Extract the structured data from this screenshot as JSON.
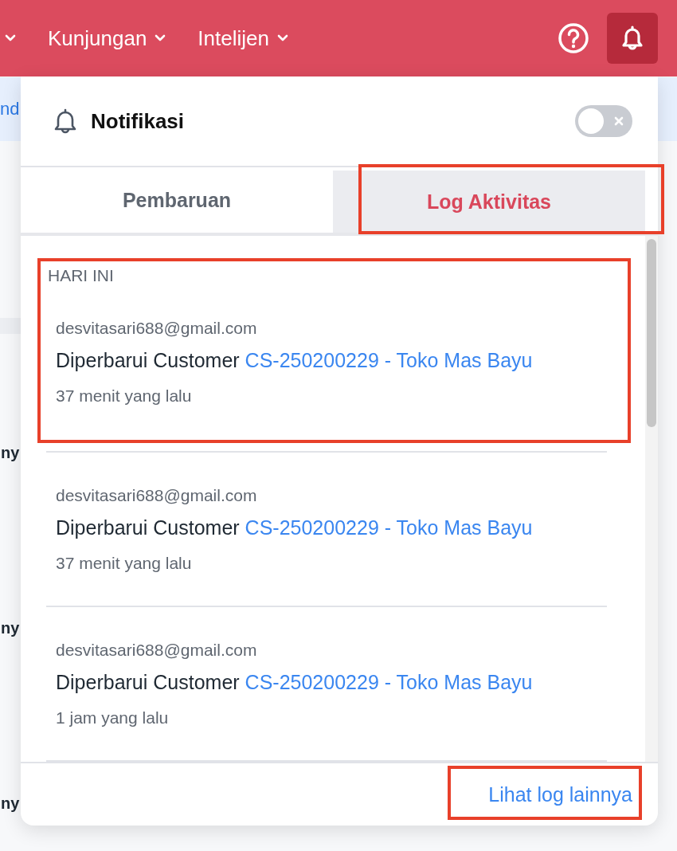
{
  "nav": {
    "items": [
      {
        "kind": "caret"
      },
      {
        "kind": "menu",
        "label": "Kunjungan"
      },
      {
        "kind": "menu",
        "label": "Intelijen"
      }
    ]
  },
  "background": {
    "banner_text": "nd",
    "row_texts": [
      "ny",
      "ny",
      "ny"
    ]
  },
  "panel": {
    "title": "Notifikasi",
    "toggle_on": false,
    "tabs": [
      {
        "label": "Pembaruan",
        "selected": false,
        "highlighted": false
      },
      {
        "label": "Log Aktivitas",
        "selected": true,
        "highlighted": true
      }
    ],
    "groups": [
      {
        "label": "HARI INI",
        "highlighted": true,
        "items": [
          {
            "user": "desvitasari688@gmail.com",
            "action": "Diperbarui Customer",
            "link": "CS-250200229 - Toko Mas Bayu",
            "time": "37 menit yang lalu"
          },
          {
            "user": "desvitasari688@gmail.com",
            "action": "Diperbarui Customer",
            "link": "CS-250200229 - Toko Mas Bayu",
            "time": "37 menit yang lalu"
          },
          {
            "user": "desvitasari688@gmail.com",
            "action": "Diperbarui Customer",
            "link": "CS-250200229 - Toko Mas Bayu",
            "time": "1 jam yang lalu"
          }
        ]
      }
    ],
    "footer_link": {
      "label": "Lihat log lainnya",
      "highlighted": true
    }
  }
}
